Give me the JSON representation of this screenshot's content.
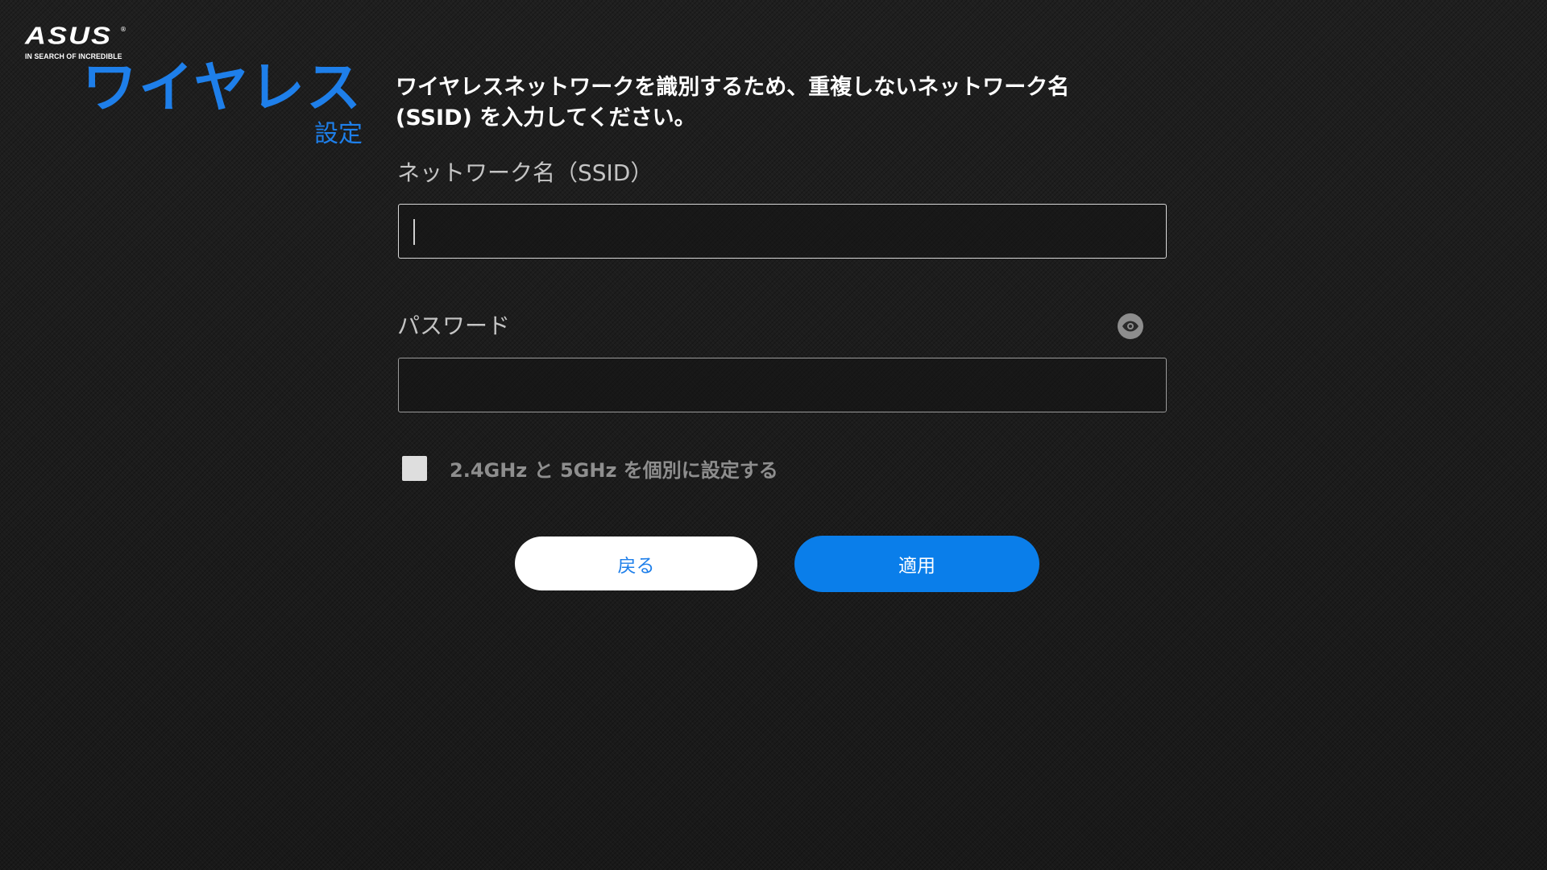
{
  "logo": {
    "brand": "ASUS",
    "registered": "®",
    "tagline": "IN SEARCH OF INCREDIBLE"
  },
  "heading": {
    "title": "ワイヤレス",
    "subtitle": "設定"
  },
  "description": "ワイヤレスネットワークを識別するため、重複しないネットワーク名 (SSID) を入力してください。",
  "ssid_field": {
    "label": "ネットワーク名（SSID）",
    "value": "",
    "placeholder": ""
  },
  "password_field": {
    "label": "パスワード",
    "value": "",
    "placeholder": "",
    "toggle_icon": "eye-icon"
  },
  "separate_bands": {
    "label": "2.4GHz と 5GHz を個別に設定する",
    "checked": false
  },
  "buttons": {
    "back_label": "戻る",
    "apply_label": "適用"
  },
  "colors": {
    "accent": "#1e7fea",
    "apply_button": "#0a7eea",
    "background": "#1c1c1c"
  }
}
